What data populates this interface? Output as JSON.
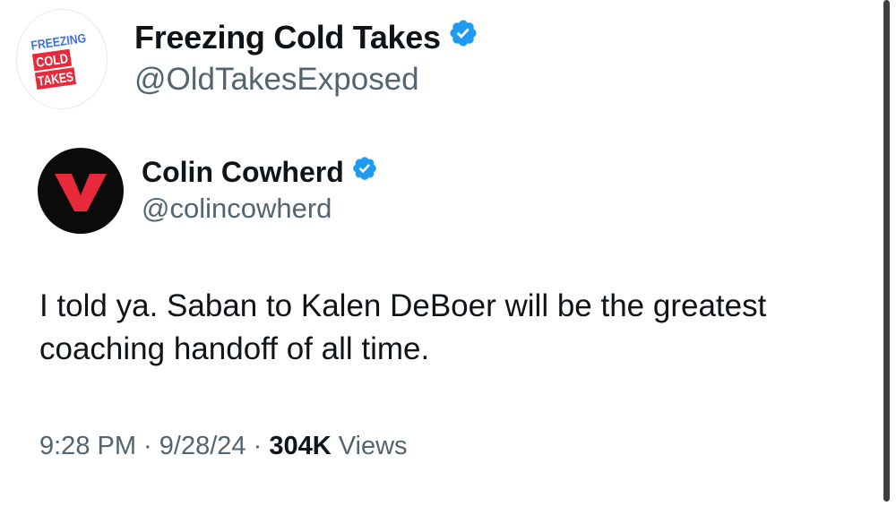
{
  "outer_tweet": {
    "display_name": "Freezing Cold Takes",
    "handle": "@OldTakesExposed",
    "avatar_logo_lines": [
      "FREEZING",
      "COLD",
      "TAKES"
    ]
  },
  "quoted_tweet": {
    "display_name": "Colin Cowherd",
    "handle": "@colincowherd",
    "avatar_letter": "V",
    "text": "I told ya. Saban to Kalen DeBoer will be the greatest coaching handoff of all time.",
    "time": "9:28 PM",
    "date": "9/28/24",
    "separator": " · ",
    "views_count": "304K",
    "views_label": " Views"
  },
  "colors": {
    "verified": "#1d9bf0",
    "handle_gray": "#536471",
    "text": "#0f1419",
    "logo_red": "#e8293b",
    "logo_blue": "#3b6fe0"
  },
  "icons": {
    "verified": "verified-badge-icon"
  }
}
